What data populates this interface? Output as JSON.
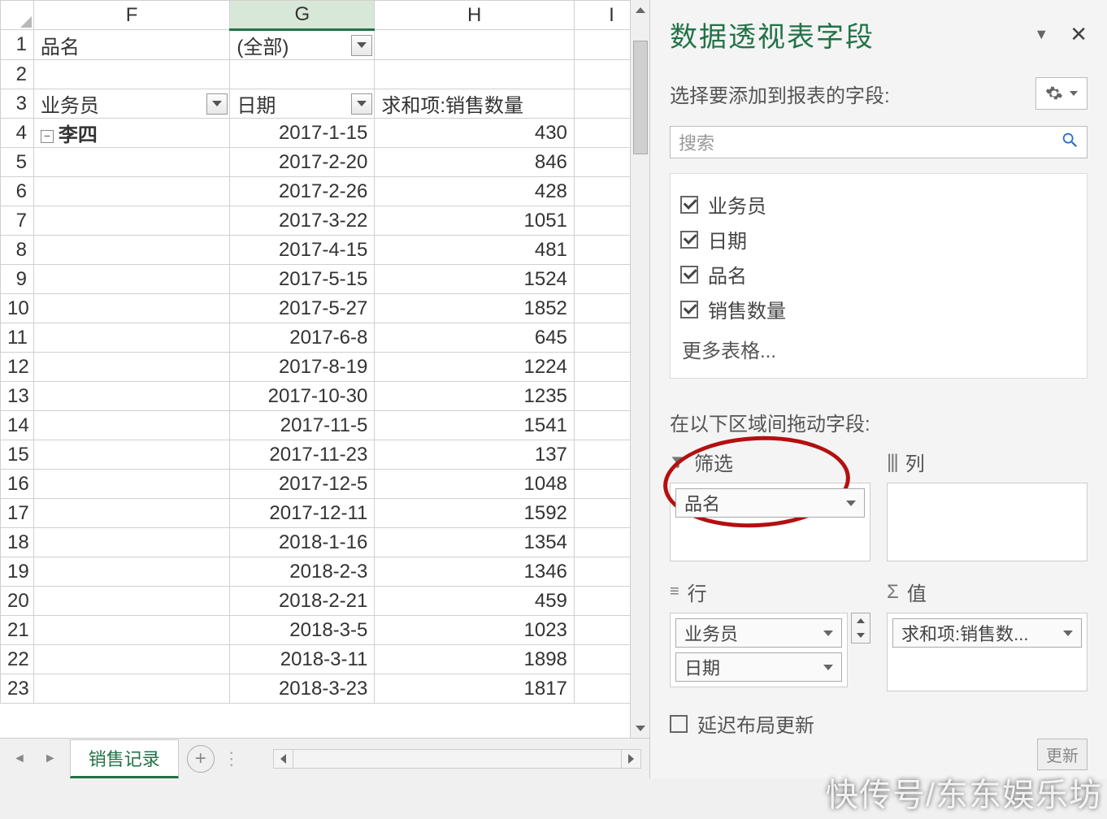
{
  "columns": [
    "F",
    "G",
    "H",
    "I"
  ],
  "selected_col": "G",
  "filter_row": {
    "label": "品名",
    "value": "(全部)"
  },
  "pivot_headers": {
    "rows_field": "业务员",
    "cols_field": "日期",
    "values_field": "求和项:销售数量"
  },
  "row_group": {
    "collapse": "−",
    "name": "李四"
  },
  "data_rows": [
    {
      "r": 4,
      "date": "2017-1-15",
      "val": "430"
    },
    {
      "r": 5,
      "date": "2017-2-20",
      "val": "846"
    },
    {
      "r": 6,
      "date": "2017-2-26",
      "val": "428"
    },
    {
      "r": 7,
      "date": "2017-3-22",
      "val": "1051"
    },
    {
      "r": 8,
      "date": "2017-4-15",
      "val": "481"
    },
    {
      "r": 9,
      "date": "2017-5-15",
      "val": "1524"
    },
    {
      "r": 10,
      "date": "2017-5-27",
      "val": "1852"
    },
    {
      "r": 11,
      "date": "2017-6-8",
      "val": "645"
    },
    {
      "r": 12,
      "date": "2017-8-19",
      "val": "1224"
    },
    {
      "r": 13,
      "date": "2017-10-30",
      "val": "1235"
    },
    {
      "r": 14,
      "date": "2017-11-5",
      "val": "1541"
    },
    {
      "r": 15,
      "date": "2017-11-23",
      "val": "137"
    },
    {
      "r": 16,
      "date": "2017-12-5",
      "val": "1048"
    },
    {
      "r": 17,
      "date": "2017-12-11",
      "val": "1592"
    },
    {
      "r": 18,
      "date": "2018-1-16",
      "val": "1354"
    },
    {
      "r": 19,
      "date": "2018-2-3",
      "val": "1346"
    },
    {
      "r": 20,
      "date": "2018-2-21",
      "val": "459"
    },
    {
      "r": 21,
      "date": "2018-3-5",
      "val": "1023"
    },
    {
      "r": 22,
      "date": "2018-3-11",
      "val": "1898"
    },
    {
      "r": 23,
      "date": "2018-3-23",
      "val": "1817"
    }
  ],
  "sheet_tab": "销售记录",
  "panel": {
    "title": "数据透视表字段",
    "subtitle": "选择要添加到报表的字段:",
    "search_placeholder": "搜索",
    "fields": [
      "业务员",
      "日期",
      "品名",
      "销售数量"
    ],
    "more_tables": "更多表格...",
    "drag_label": "在以下区域间拖动字段:",
    "area_filter": "筛选",
    "area_columns": "列",
    "area_rows": "行",
    "area_values": "值",
    "chip_filter": "品名",
    "chip_rows": [
      "业务员",
      "日期"
    ],
    "chip_values": "求和项:销售数...",
    "defer": "延迟布局更新",
    "update": "更新"
  },
  "watermark": "快传号/东东娱乐坊"
}
